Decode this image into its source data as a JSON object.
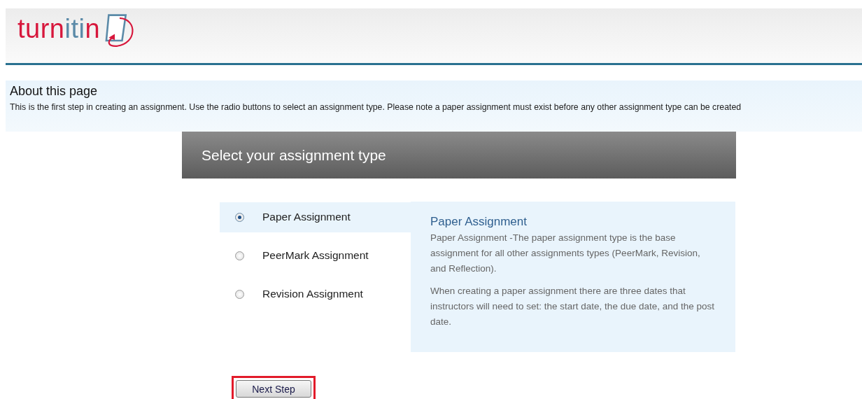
{
  "logo": {
    "parts": [
      {
        "text": "turn",
        "color": "#d7173c"
      },
      {
        "text": "iti",
        "color": "#5b8aa8"
      },
      {
        "text": "n",
        "color": "#d7173c"
      }
    ]
  },
  "about": {
    "title": "About this page",
    "text": "This is the first step in creating an assignment. Use the radio buttons to select an assignment type. Please note a paper assignment must exist before any other assignment type can be created"
  },
  "panel": {
    "title": "Select your assignment type"
  },
  "options": [
    {
      "label": "Paper Assignment",
      "selected": true
    },
    {
      "label": "PeerMark Assignment",
      "selected": false
    },
    {
      "label": "Revision Assignment",
      "selected": false
    }
  ],
  "description": {
    "title": "Paper Assignment",
    "paragraphs": [
      "Paper Assignment -The paper assignment type is the base assignment for all other assignments types (PeerMark, Revision, and Reflection).",
      "When creating a paper assignment there are three dates that instructors will need to set: the start date, the due date, and the post date."
    ]
  },
  "next_button": {
    "label": "Next Step",
    "highlighted": true
  }
}
